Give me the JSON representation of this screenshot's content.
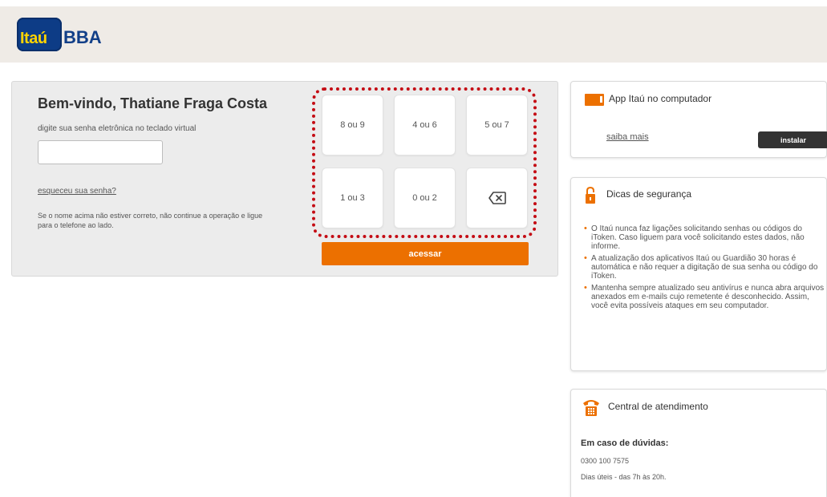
{
  "brand": {
    "logo_main": "Itaú",
    "logo_suffix": "BBA"
  },
  "login": {
    "welcome": "Bem-vindo, Thatiane Fraga Costa",
    "instruction": "digite sua senha eletrônica no teclado virtual",
    "password_value": "",
    "forgot_link": "esqueceu sua senha?",
    "warning": "Se o nome acima não estiver correto, não continue a operação e ligue para o telefone ao lado."
  },
  "keypad": {
    "keys": [
      "8 ou 9",
      "4 ou 6",
      "5 ou 7",
      "1 ou 3",
      "0 ou 2"
    ],
    "backspace_icon": "backspace-icon"
  },
  "submit_label": "acessar",
  "app_card": {
    "title": "App Itaú no computador",
    "link": "saiba mais",
    "button": "instalar",
    "icon": "laptop-icon"
  },
  "security": {
    "title": "Dicas de segurança",
    "icon": "lock-icon",
    "tips": [
      "O Itaú nunca faz ligações solicitando senhas ou códigos do iToken. Caso liguem para você solicitando estes dados, não informe.",
      "A atualização dos aplicativos Itaú ou Guardião 30 horas é automática e não requer a digitação de sua senha ou código do iToken.",
      "Mantenha sempre atualizado seu antivírus e nunca abra arquivos anexados em e-mails cujo remetente é desconhecido. Assim, você evita possíveis ataques em seu computador."
    ]
  },
  "central": {
    "title": "Central de atendimento",
    "icon": "phone-icon",
    "question": "Em caso de dúvidas:",
    "phone": "0300 100 7575",
    "hours": "Dias úteis - das 7h às 20h."
  },
  "colors": {
    "accent": "#ec7000",
    "brand_blue": "#123f88",
    "logo_yellow": "#ffd400",
    "keypad_highlight": "#c40c14"
  }
}
